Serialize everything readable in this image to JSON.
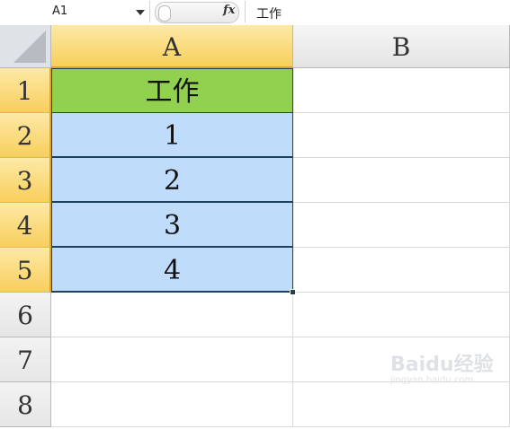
{
  "formula_bar": {
    "name_box": "A1",
    "fx_label": "fx",
    "content": "工作"
  },
  "columns": [
    "A",
    "B"
  ],
  "selected_column": "A",
  "rows": [
    "1",
    "2",
    "3",
    "4",
    "5",
    "6",
    "7",
    "8"
  ],
  "cells": {
    "A1": "工作",
    "A2": "1",
    "A3": "2",
    "A4": "3",
    "A5": "4"
  },
  "colors": {
    "header_fill": "#92d050",
    "data_fill": "#bfdcfb",
    "selection_header": "#f8cf5c",
    "border_dark": "#1f3f5f"
  },
  "watermark": {
    "main": "Baidu经验",
    "sub": "jingyan.baidu.com"
  }
}
